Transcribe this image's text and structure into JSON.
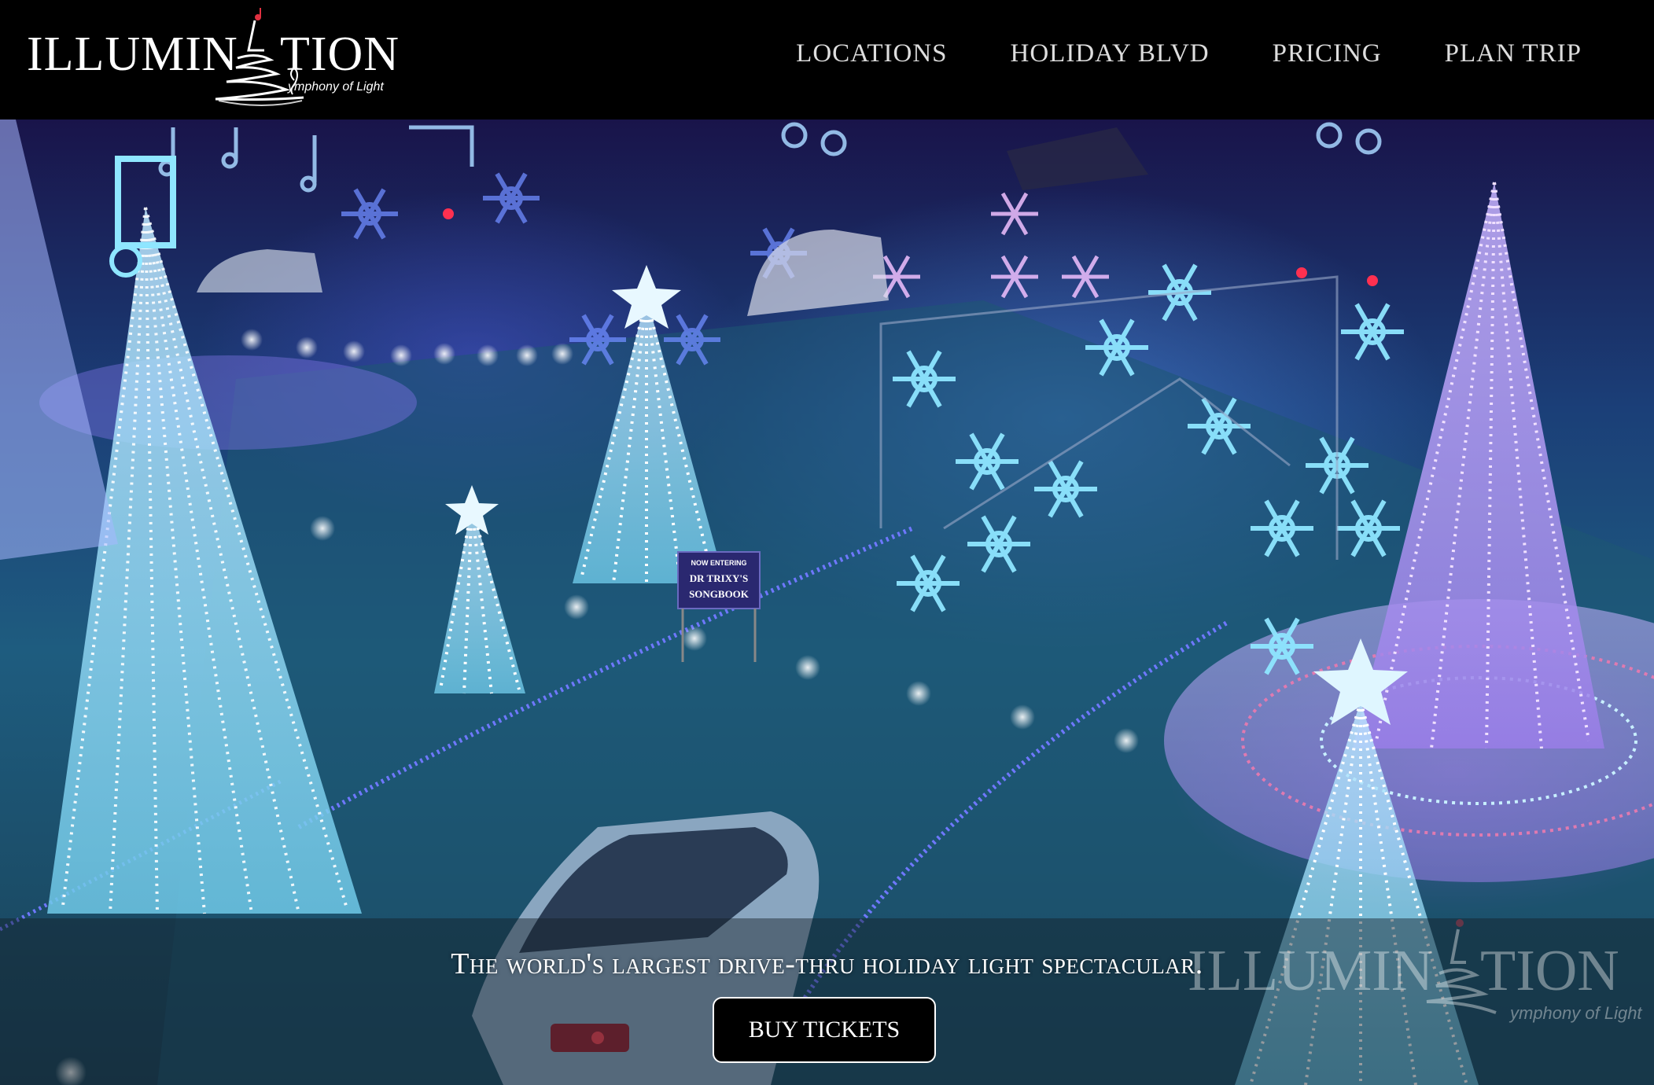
{
  "brand": {
    "name_left": "ILLUMIN",
    "name_right": "TION",
    "tagline": "ymphony of Light"
  },
  "nav": {
    "items": [
      {
        "label": "LOCATIONS"
      },
      {
        "label": "HOLIDAY BLVD"
      },
      {
        "label": "PRICING"
      },
      {
        "label": "PLAN TRIP"
      }
    ]
  },
  "hero": {
    "tagline": "The world's largest drive-thru holiday light spectacular.",
    "cta_label": "BUY TICKETS",
    "sign_line1": "NOW ENTERING",
    "sign_line2": "DR TRIXY'S",
    "sign_line3": "SONGBOOK",
    "watermark_left": "ILLUMIN",
    "watermark_right": "TION",
    "watermark_tagline": "ymphony of Light"
  },
  "colors": {
    "header_bg": "#000000",
    "cta_bg": "#000000",
    "text": "#ffffff"
  }
}
